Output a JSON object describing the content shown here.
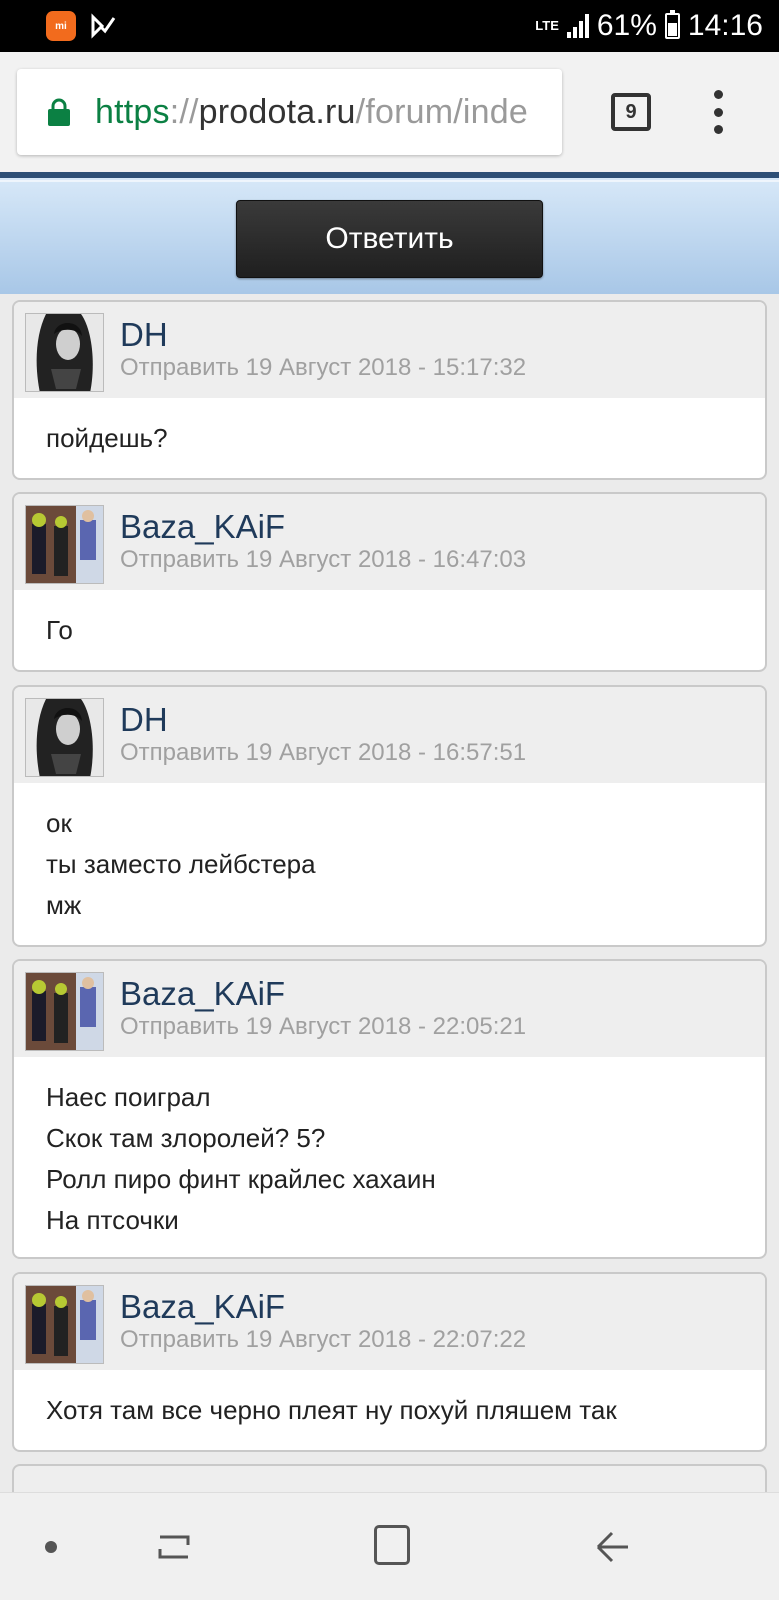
{
  "status_bar": {
    "network": "LTE",
    "battery_percent": "61%",
    "battery_level": 0.61,
    "time": "14:16"
  },
  "browser": {
    "url_scheme": "https",
    "url_sep": "://",
    "url_host": "prodota.ru",
    "url_path": "/forum/inde",
    "tab_count": "9"
  },
  "reply_button_label": "Ответить",
  "posts": [
    {
      "author": "DH",
      "date": "Отправить 19 Август 2018 - 15:17:32",
      "lines": [
        "пойдешь?"
      ]
    },
    {
      "author": "Baza_KAiF",
      "date": "Отправить 19 Август 2018 - 16:47:03",
      "lines": [
        "Го"
      ]
    },
    {
      "author": "DH",
      "date": "Отправить 19 Август 2018 - 16:57:51",
      "lines": [
        "ок",
        "ты заместо лейбстера",
        "мж"
      ]
    },
    {
      "author": "Baza_KAiF",
      "date": "Отправить 19 Август 2018 - 22:05:21",
      "lines": [
        "Наес поиграл",
        "Скок там злоролей? 5?",
        "Ролл пиро финт крайлес хахаин",
        "На птсочки"
      ]
    },
    {
      "author": "Baza_KAiF",
      "date": "Отправить 19 Август 2018 - 22:07:22",
      "lines": [
        "Хотя там все черно плеят ну похуй пляшем так"
      ]
    }
  ]
}
